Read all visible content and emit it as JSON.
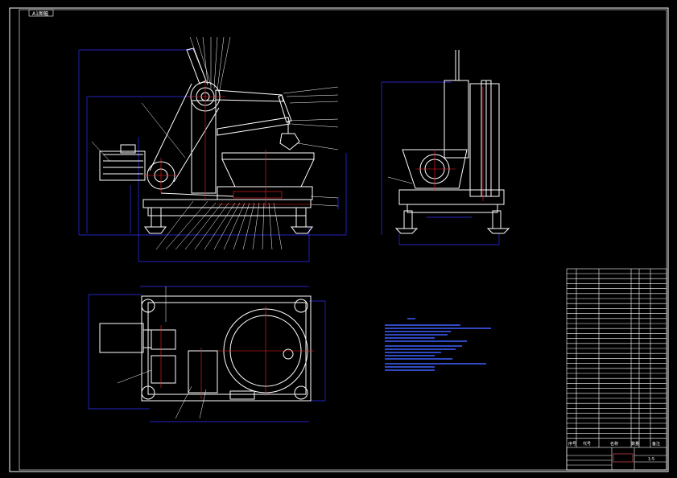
{
  "sheet": {
    "tag": "A1图幅"
  },
  "colors": {
    "background": "#000000",
    "frame": "#ffffff",
    "outline": "#ffffff",
    "dimension": "#3030ff",
    "centerline": "#ff2020",
    "leader": "#ffffff",
    "hatch": "#ff3030",
    "notes": "#4060ff"
  },
  "title_block": {
    "headers": [
      "序号",
      "代号",
      "名称",
      "数量",
      "备注"
    ]
  },
  "labels": {
    "scale": "1:5"
  }
}
